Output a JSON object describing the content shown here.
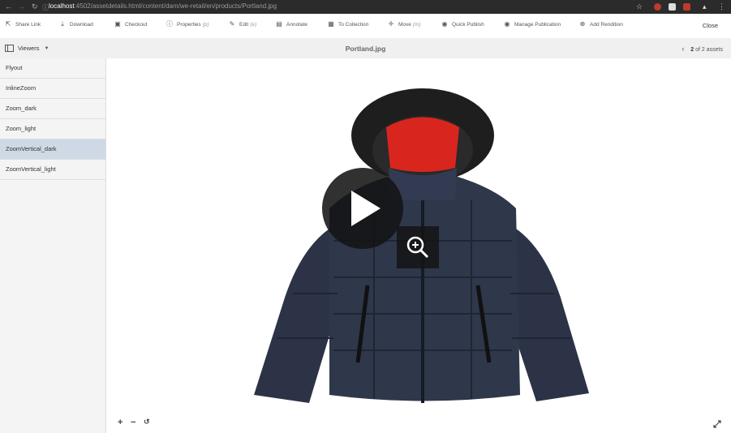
{
  "browser": {
    "url_host": "localhost",
    "url_path": ":4502/assetdetails.html/content/dam/we-retail/en/products/Portland.jpg"
  },
  "toolbar": {
    "items": [
      {
        "label": "Share Link",
        "icon": "share-icon"
      },
      {
        "label": "Download",
        "icon": "download-icon"
      },
      {
        "label": "Checkout",
        "icon": "lock-icon"
      },
      {
        "label": "Properties",
        "shortcut": "(p)",
        "icon": "info-icon"
      },
      {
        "label": "Edit",
        "shortcut": "(e)",
        "icon": "pencil-icon"
      },
      {
        "label": "Annotate",
        "icon": "comment-icon"
      },
      {
        "label": "To Collection",
        "icon": "collection-icon"
      },
      {
        "label": "Move",
        "shortcut": "(m)",
        "icon": "move-icon"
      },
      {
        "label": "Quick Publish",
        "icon": "globe-icon"
      },
      {
        "label": "Manage Publication",
        "icon": "globe-gear-icon"
      },
      {
        "label": "Add Rendition",
        "icon": "add-circle-icon"
      }
    ],
    "close_label": "Close"
  },
  "subbar": {
    "viewers_label": "Viewers",
    "title": "Portland.jpg",
    "pager_current": "2",
    "pager_text": "of 2 assets"
  },
  "sidebar": {
    "items": [
      {
        "label": "Flyout",
        "selected": false
      },
      {
        "label": "InlineZoom",
        "selected": false
      },
      {
        "label": "Zoom_dark",
        "selected": false
      },
      {
        "label": "Zoom_light",
        "selected": false
      },
      {
        "label": "ZoomVertical_dark",
        "selected": true
      },
      {
        "label": "ZoomVertical_light",
        "selected": false
      }
    ]
  },
  "colors": {
    "jacket": "#2c3346",
    "hood_fur": "#1e1e1e",
    "lining": "#d8261f",
    "selected_row": "#cfd9e6"
  }
}
